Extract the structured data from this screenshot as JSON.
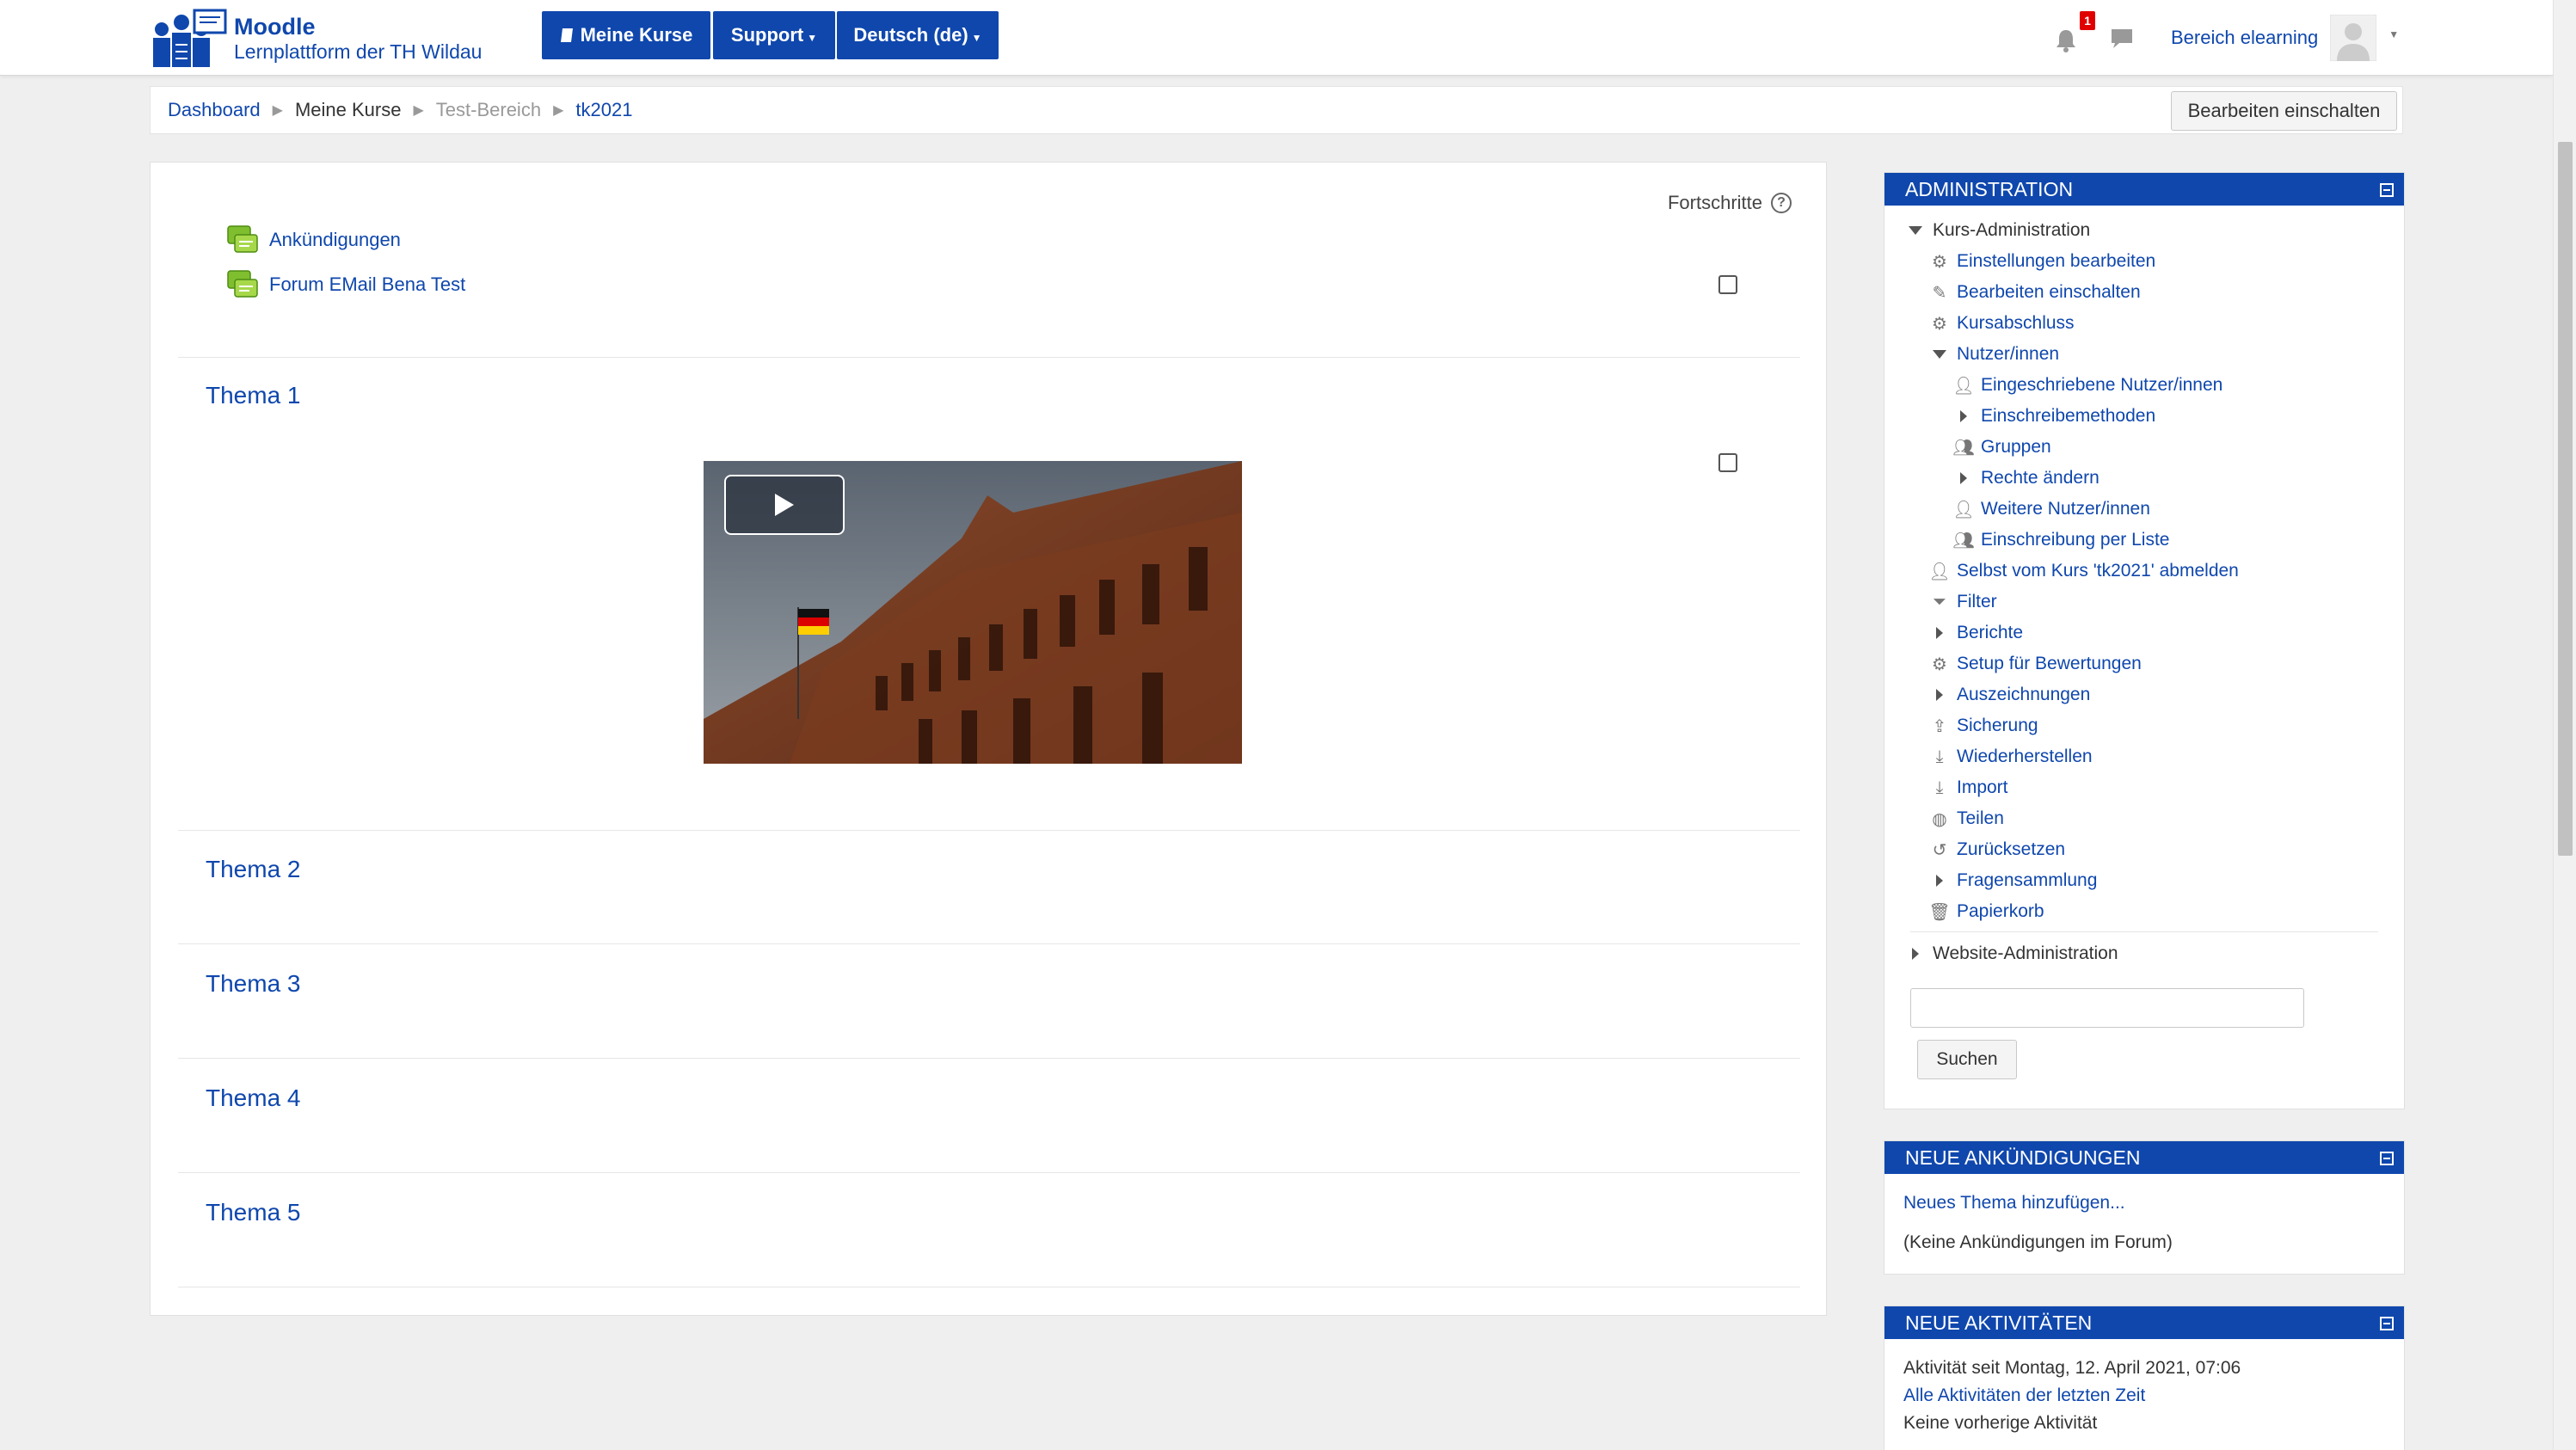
{
  "navbar": {
    "brand_title": "Moodle",
    "brand_subtitle": "Lernplattform der TH Wildau",
    "my_courses": "Meine Kurse",
    "support": "Support",
    "language": "Deutsch (de)",
    "notification_count": "1",
    "user_name": "Bereich elearning"
  },
  "breadcrumb": {
    "items": [
      "Dashboard",
      "Meine Kurse",
      "Test-Bereich",
      "tk2021"
    ]
  },
  "edit_button": "Bearbeiten einschalten",
  "course": {
    "progress_label": "Fortschritte",
    "help_glyph": "?",
    "activities": [
      "Ankündigungen",
      "Forum EMail Bena Test"
    ],
    "topics": [
      "Thema 1",
      "Thema 2",
      "Thema 3",
      "Thema 4",
      "Thema 5"
    ]
  },
  "admin_block": {
    "title": "ADMINISTRATION",
    "course_admin": "Kurs-Administration",
    "items": {
      "settings": "Einstellungen bearbeiten",
      "edit_on": "Bearbeiten einschalten",
      "completion": "Kursabschluss",
      "users": "Nutzer/innen",
      "enrolled": "Eingeschriebene Nutzer/innen",
      "enrol_methods": "Einschreibemethoden",
      "groups": "Gruppen",
      "permissions": "Rechte ändern",
      "other_users": "Weitere Nutzer/innen",
      "enrol_list": "Einschreibung per Liste",
      "unenrol": "Selbst vom Kurs 'tk2021' abmelden",
      "filter": "Filter",
      "reports": "Berichte",
      "gradebook": "Setup für Bewertungen",
      "badges": "Auszeichnungen",
      "backup": "Sicherung",
      "restore": "Wiederherstellen",
      "import": "Import",
      "share": "Teilen",
      "reset": "Zurücksetzen",
      "question_bank": "Fragensammlung",
      "recycle_bin": "Papierkorb"
    },
    "site_admin": "Website-Administration",
    "search_value": "",
    "search_button": "Suchen"
  },
  "news_block": {
    "title": "NEUE ANKÜNDIGUNGEN",
    "add_link": "Neues Thema hinzufügen...",
    "empty_text": "(Keine Ankündigungen im Forum)"
  },
  "activity_block": {
    "title": "NEUE AKTIVITÄTEN",
    "since": "Aktivität seit Montag, 12. April 2021, 07:06",
    "all_link": "Alle Aktivitäten der letzten Zeit",
    "none_text": "Keine vorherige Aktivität"
  },
  "colors": {
    "primary": "#0f47ad",
    "background": "#efefef",
    "badge": "#e00000"
  }
}
